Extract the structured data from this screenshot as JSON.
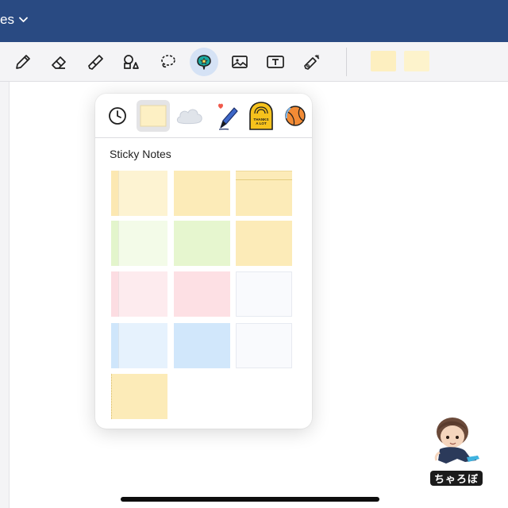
{
  "header": {
    "title": "es",
    "bg_color": "#294a82"
  },
  "toolbar": {
    "tools": [
      {
        "name": "pen",
        "icon": "pencil-icon"
      },
      {
        "name": "eraser",
        "icon": "eraser-icon"
      },
      {
        "name": "highlighter",
        "icon": "highlighter-icon"
      },
      {
        "name": "shapes",
        "icon": "shapes-icon"
      },
      {
        "name": "lasso",
        "icon": "lasso-icon"
      },
      {
        "name": "elements",
        "icon": "sticker-icon",
        "active": true
      },
      {
        "name": "image",
        "icon": "image-icon"
      },
      {
        "name": "text",
        "icon": "text-box-icon"
      },
      {
        "name": "laser",
        "icon": "laser-pointer-icon"
      }
    ],
    "recent_swatches": [
      "#fdefc0",
      "#fdf3cc"
    ]
  },
  "popup": {
    "heading": "Sticky Notes",
    "tabs": [
      {
        "name": "recent",
        "icon": "clock-icon"
      },
      {
        "name": "sticky-notes",
        "icon": "sticky-note-icon",
        "selected": true
      },
      {
        "name": "clouds",
        "icon": "cloud-icon"
      },
      {
        "name": "doodles",
        "icon": "pen-heart-icon"
      },
      {
        "name": "badges",
        "icon": "thanks-badge-icon",
        "text": "THANKS A LOT"
      },
      {
        "name": "more",
        "icon": "ball-icon"
      }
    ],
    "notes": [
      {
        "style": "spine",
        "color": "#fdf3d2",
        "accent": "#fce8b2"
      },
      {
        "style": "plain",
        "color": "#fcebb8"
      },
      {
        "style": "topline",
        "color": "#fcebb8"
      },
      {
        "style": "spine",
        "color": "#f3fbe8",
        "accent": "#e3f5cc"
      },
      {
        "style": "plain",
        "color": "#e6f6cf"
      },
      {
        "style": "lined",
        "color": "#fcebb8"
      },
      {
        "style": "spine",
        "color": "#fdebee",
        "accent": "#fcdde2"
      },
      {
        "style": "plain",
        "color": "#fde0e4"
      },
      {
        "style": "grid",
        "color": "#f9fafd"
      },
      {
        "style": "spine",
        "color": "#e6f2fd",
        "accent": "#cfe6fb"
      },
      {
        "style": "plain",
        "color": "#d1e7fb"
      },
      {
        "style": "grid",
        "color": "#f9fafd"
      },
      {
        "style": "lined-dots",
        "color": "#fcebb8"
      }
    ]
  },
  "watermark": {
    "label": "ちゃろぼ"
  }
}
